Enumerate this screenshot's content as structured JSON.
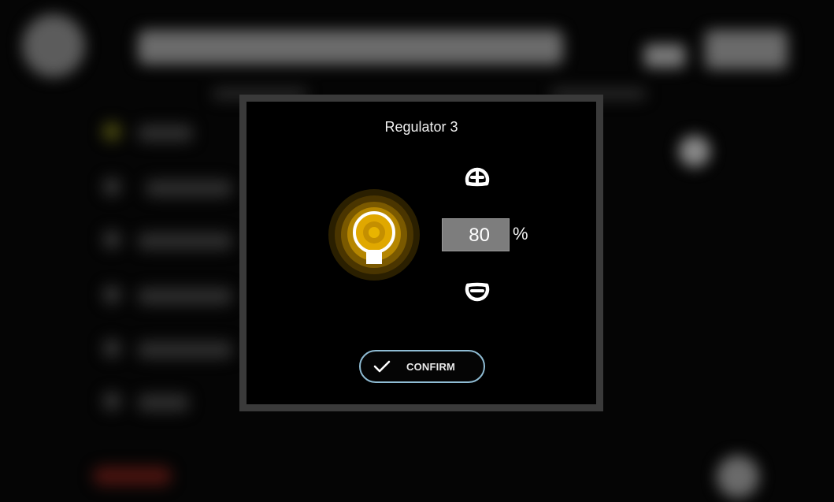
{
  "dialog": {
    "title": "Regulator 3",
    "value": "80",
    "unit": "%",
    "confirm_label": "CONFIRM",
    "bulb_color": "#e0a800",
    "accent_border": "#8fbcd4"
  },
  "icons": {
    "increase": "plus-circle-icon",
    "decrease": "minus-circle-icon",
    "confirm": "check-icon",
    "bulb": "light-bulb-icon"
  }
}
